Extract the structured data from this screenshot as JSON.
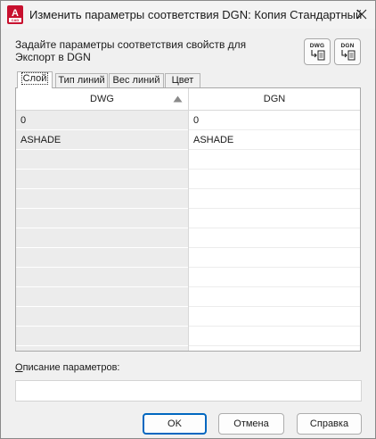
{
  "window": {
    "title": "Изменить параметры соответствия DGN:  Копия Стандартный",
    "app_icon": "autocad-icon",
    "close_icon": "close-icon"
  },
  "instruction": "Задайте параметры соответствия свойств для\nЭкспорт в DGN",
  "toolbar": {
    "dwg_label": "DWG",
    "dgn_label": "DGN"
  },
  "tabs": [
    {
      "label": "Слой",
      "active": true
    },
    {
      "label": "Тип линий",
      "active": false
    },
    {
      "label": "Вес линий",
      "active": false
    },
    {
      "label": "Цвет",
      "active": false
    }
  ],
  "table": {
    "columns": [
      "DWG",
      "DGN"
    ],
    "sort": "ascending",
    "rows": [
      {
        "dwg": "0",
        "dgn": "0"
      },
      {
        "dwg": "ASHADE",
        "dgn": "ASHADE"
      }
    ]
  },
  "description": {
    "label_underlined": "О",
    "label_rest": "писание параметров:",
    "value": ""
  },
  "buttons": {
    "ok": "OK",
    "cancel": "Отмена",
    "help": "Справка"
  }
}
